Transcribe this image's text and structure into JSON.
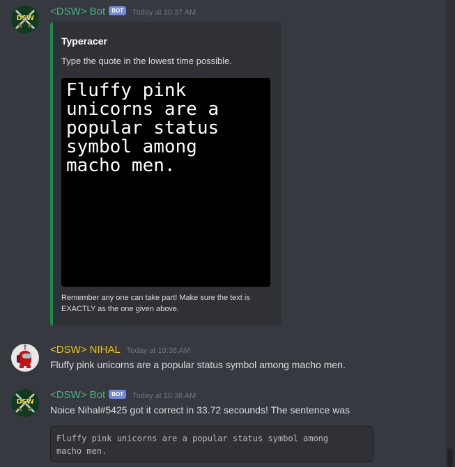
{
  "messages": [
    {
      "author": "<DSW> Bot",
      "bot_badge": "BOT",
      "timestamp": "Today at 10:37 AM",
      "avatar_icon": "dsw-crossed-swords-logo",
      "avatar_logo_text": "DSW",
      "embed": {
        "accent_color": "#1f8b4c",
        "title": "Typeracer",
        "description": "Type the quote in the lowest time possible.",
        "image_text": "Fluffy pink\nunicorns are a\npopular status\nsymbol among\nmacho men.",
        "footer": "Remember any one can take part! Make sure the text is EXACTLY as the one given above."
      }
    },
    {
      "author": "<DSW> NIHAL",
      "timestamp": "Today at 10:38 AM",
      "avatar_icon": "red-among-us-crewmate-avatar",
      "content": "Fluffy pink unicorns are a popular status symbol among macho men."
    },
    {
      "author": "<DSW> Bot",
      "bot_badge": "BOT",
      "timestamp": "Today at 10:38 AM",
      "avatar_icon": "dsw-crossed-swords-logo",
      "avatar_logo_text": "DSW",
      "content": "Noice Nihal#5425 got it correct in 33.72 secounds! The sentence was",
      "code": "Fluffy pink unicorns are a popular status symbol among\nmacho men."
    }
  ],
  "colors": {
    "background": "#36393f",
    "embed_background": "#2f3136",
    "bot_name": "#43b581",
    "nihal_name": "#f1c40f",
    "bot_badge": "#7289da"
  }
}
